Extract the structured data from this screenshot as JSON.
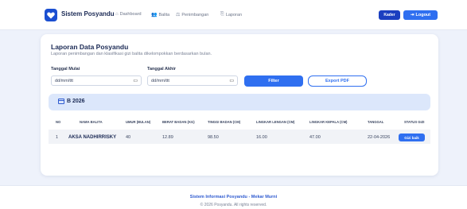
{
  "nav": {
    "brand": "Sistem Posyandu",
    "links": [
      {
        "label": "Dashboard",
        "icon": "home-icon"
      },
      {
        "label": "Balita",
        "icon": "users-icon"
      },
      {
        "label": "Penimbangan",
        "icon": "scale-icon"
      },
      {
        "label": "Laporan",
        "icon": "report-icon"
      }
    ],
    "role_badge": "Kader",
    "logout": "Logout"
  },
  "report": {
    "title": "Laporan Data Posyandu",
    "subtitle": "Laporan penimbangan dan klasifikasi gizi balita dikelompokkan berdasarkan bulan.",
    "start_label": "Tanggal Mulai",
    "end_label": "Tanggal Akhir",
    "start_value": "dd/mm/ttt",
    "end_value": "dd/mm/ttt",
    "filter_button": "Filter",
    "export_button": "Export PDF"
  },
  "group": {
    "label": "B 2026"
  },
  "table": {
    "headers": [
      "NO",
      "NAMA BALITA",
      "UMUR (BULAN)",
      "BERAT BADAN (KG)",
      "TINGGI BADAN (CM)",
      "LINGKAR LENGAN (CM)",
      "LINGKAR KEPALA (CM)",
      "TANGGAL",
      "STATUS GIZI"
    ],
    "rows": [
      {
        "no": "1",
        "name": "AKSA NADHIRRISKY",
        "age": "40",
        "weight": "12.89",
        "height": "98.50",
        "arm": "16.00",
        "head": "47.00",
        "date": "22-04-2026",
        "status": "Gizi baik"
      }
    ]
  },
  "footer": {
    "title": "Sistem Informasi Posyandu - Mekar Murni",
    "copy": "© 2026 Posyandu. All rights reserved."
  },
  "colors": {
    "accent": "#2f6ff0",
    "brand": "#1b4fd1",
    "background": "#eef2fb"
  }
}
